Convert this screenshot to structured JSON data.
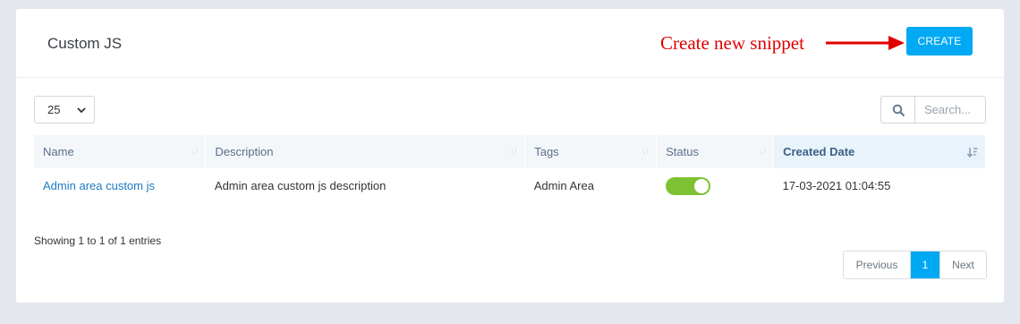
{
  "header": {
    "title": "Custom JS",
    "create_label": "CREATE"
  },
  "annotation": {
    "text": "Create new snippet",
    "color": "#e00000"
  },
  "controls": {
    "page_length": "25",
    "search_placeholder": "Search..."
  },
  "table": {
    "columns": [
      "Name",
      "Description",
      "Tags",
      "Status",
      "Created Date"
    ],
    "rows": [
      {
        "name": "Admin area custom js",
        "description": "Admin area custom js description",
        "tags": "Admin Area",
        "status": "on",
        "created": "17-03-2021 01:04:55"
      }
    ]
  },
  "footer": {
    "info": "Showing 1 to 1 of 1 entries",
    "prev": "Previous",
    "page": "1",
    "next": "Next"
  },
  "colors": {
    "accent": "#00a9f4",
    "toggle_on": "#7dc233",
    "link": "#1d7bc0"
  }
}
